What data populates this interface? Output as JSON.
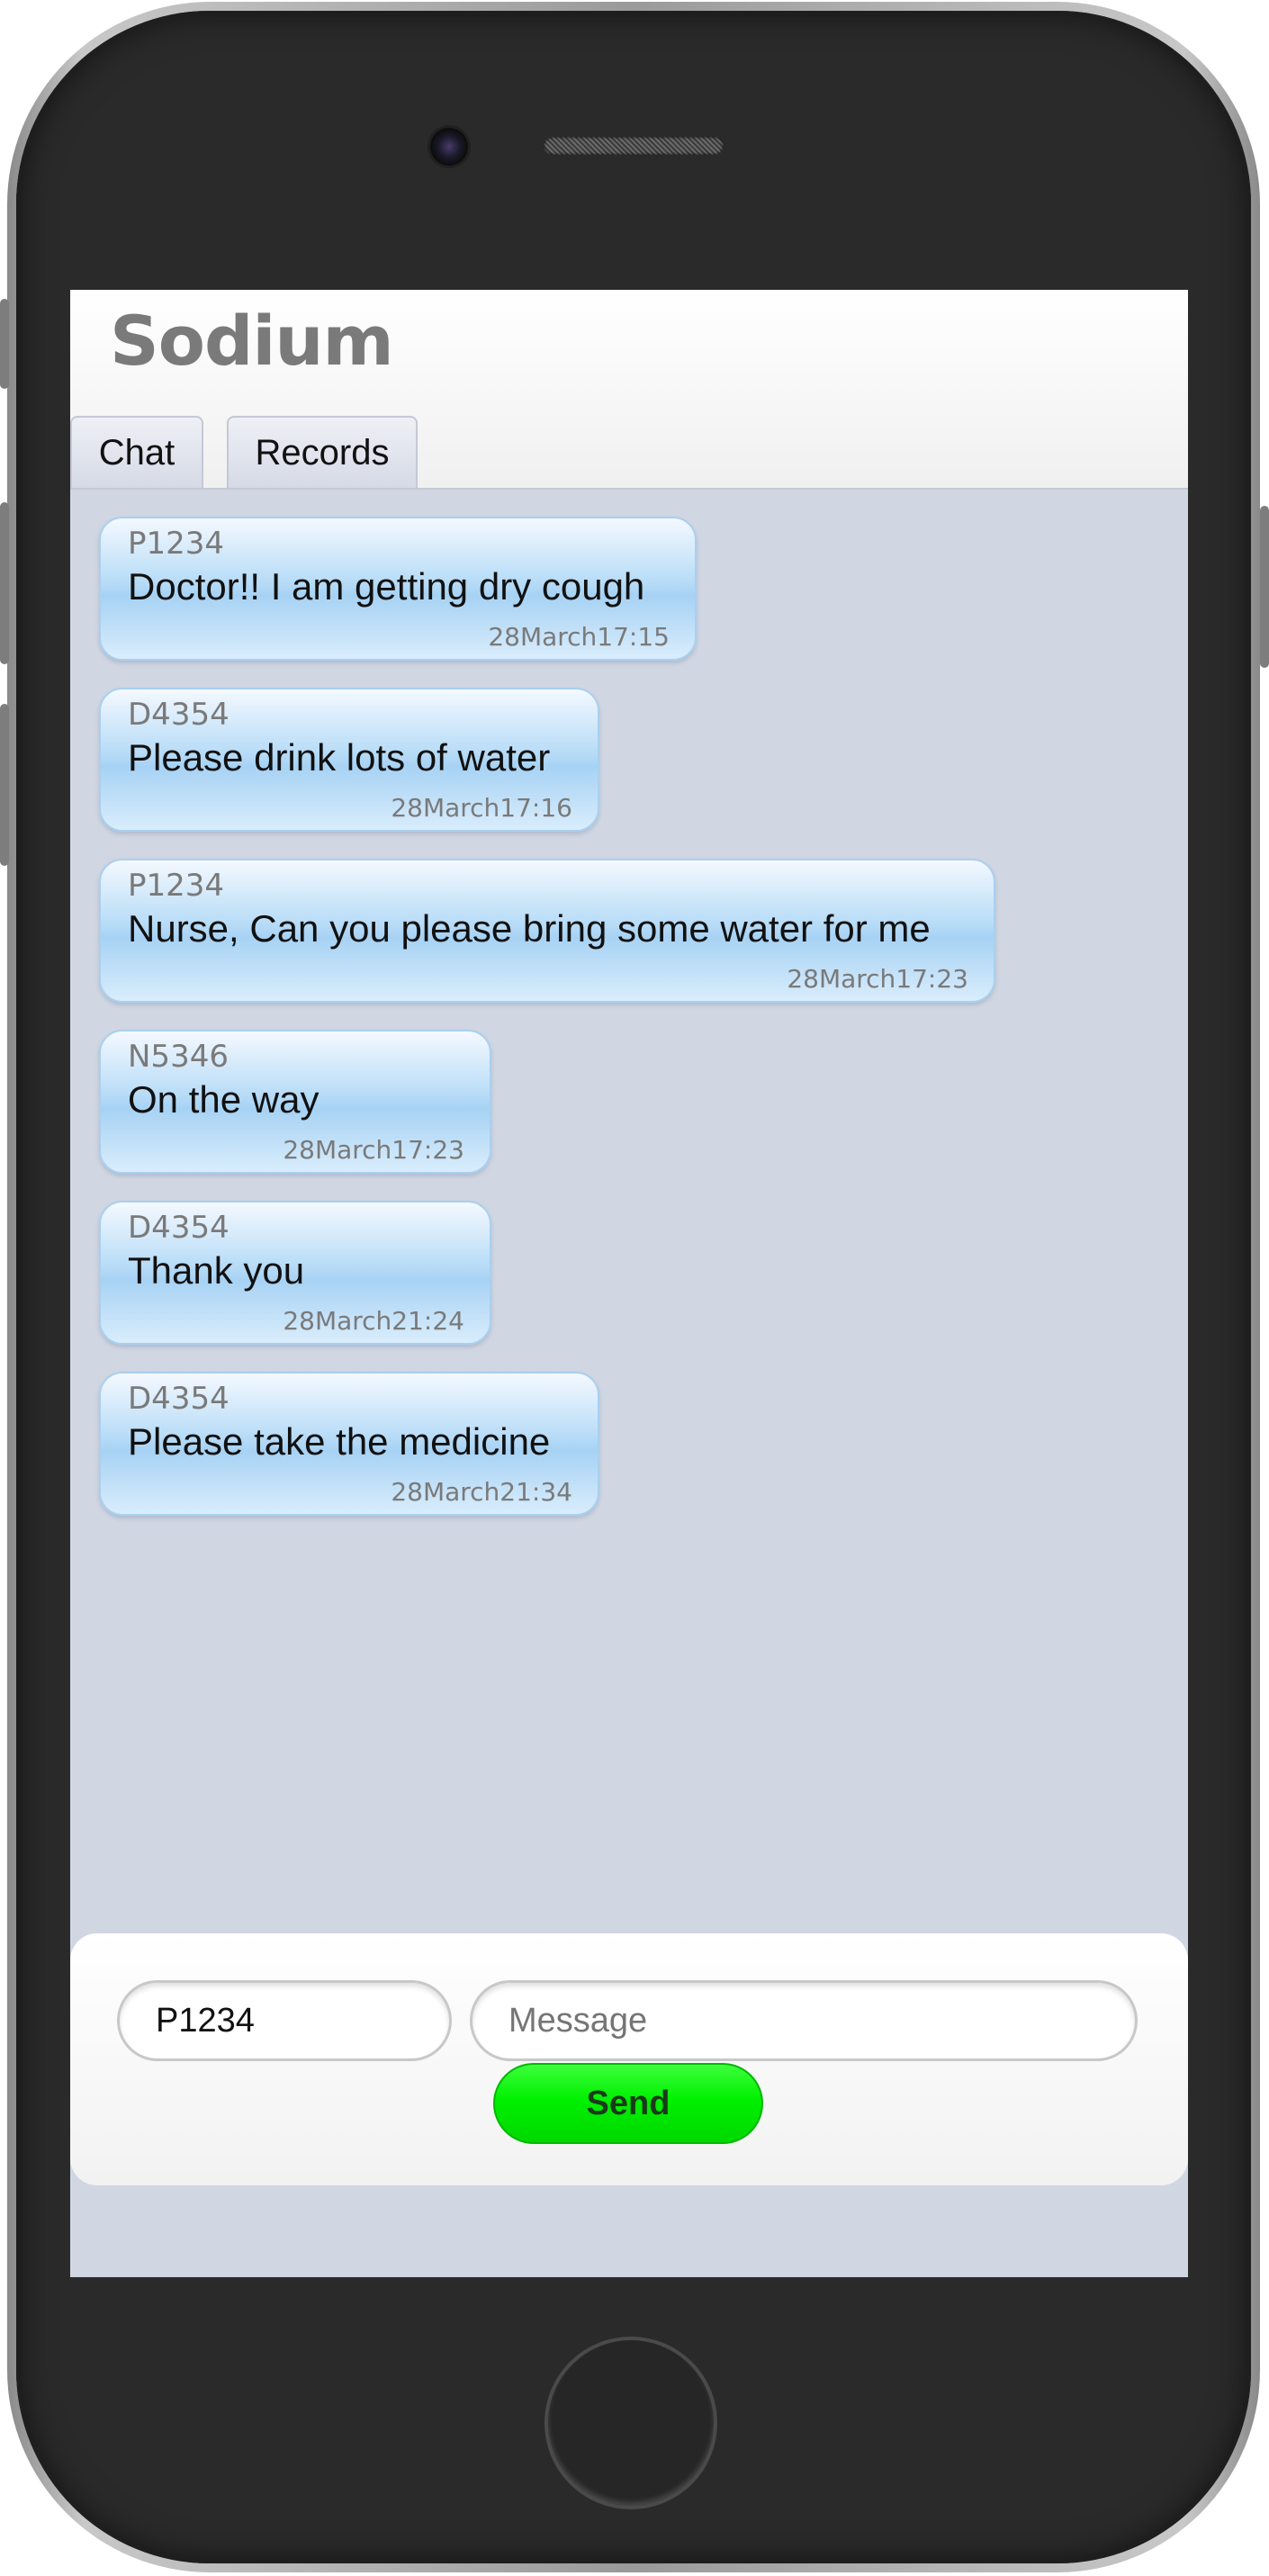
{
  "app": {
    "title": "Sodium"
  },
  "tabs": [
    {
      "label": "Chat"
    },
    {
      "label": "Records"
    }
  ],
  "messages": [
    {
      "sender": "P1234",
      "text": "Doctor!! I am getting dry cough",
      "time": "28March17:15"
    },
    {
      "sender": "D4354",
      "text": "Please drink lots of water",
      "time": "28March17:16"
    },
    {
      "sender": "P1234",
      "text": "Nurse, Can you please bring some water for me",
      "time": "28March17:23"
    },
    {
      "sender": "N5346",
      "text": "On the way",
      "time": "28March17:23"
    },
    {
      "sender": "D4354",
      "text": "Thank you",
      "time": "28March21:24"
    },
    {
      "sender": "D4354",
      "text": "Please take the medicine",
      "time": "28March21:34"
    }
  ],
  "composer": {
    "sender_value": "P1234",
    "message_placeholder": "Message",
    "send_label": "Send"
  },
  "colors": {
    "send_button": "#00f000",
    "bubble": "#b8dcf7",
    "chat_background": "#d0d6e2"
  }
}
